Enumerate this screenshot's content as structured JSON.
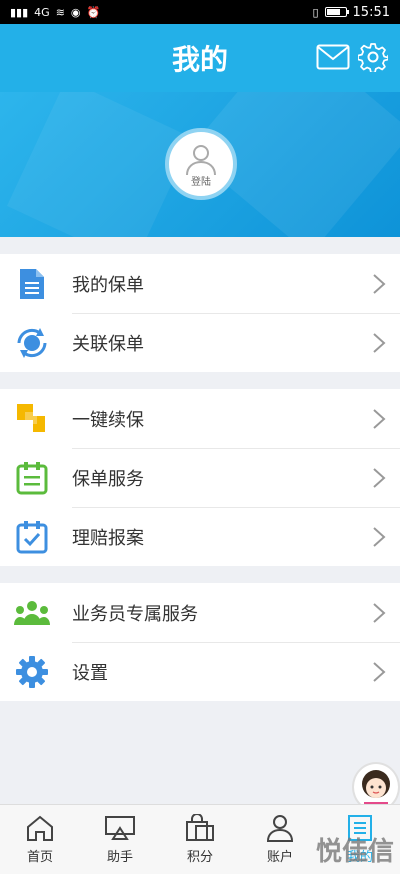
{
  "status_bar": {
    "time": "15:51",
    "network": "4G",
    "battery_level": 0.75
  },
  "header": {
    "title": "我的",
    "mail_icon": "mail-icon",
    "settings_icon": "gear-icon"
  },
  "profile": {
    "login_label": "登陆"
  },
  "menu_groups": [
    [
      {
        "label": "我的保单",
        "icon": "document-icon",
        "color": "#3d8fe0"
      },
      {
        "label": "关联保单",
        "icon": "sync-icon",
        "color": "#3d8fe0"
      }
    ],
    [
      {
        "label": "一键续保",
        "icon": "puzzle-icon",
        "color": "#f5b800"
      },
      {
        "label": "保单服务",
        "icon": "clipboard-icon",
        "color": "#5bbb3c"
      },
      {
        "label": "理赔报案",
        "icon": "calendar-check-icon",
        "color": "#3d8fe0"
      }
    ],
    [
      {
        "label": "业务员专属服务",
        "icon": "people-icon",
        "color": "#5bbb3c"
      },
      {
        "label": "设置",
        "icon": "settings-gear-icon",
        "color": "#3d8fe0"
      }
    ]
  ],
  "tabs": [
    {
      "label": "首页",
      "icon": "home-icon"
    },
    {
      "label": "助手",
      "icon": "cast-icon"
    },
    {
      "label": "积分",
      "icon": "shopping-bag-icon"
    },
    {
      "label": "账户",
      "icon": "user-icon"
    },
    {
      "label": "我的",
      "icon": "list-icon",
      "active": true
    }
  ],
  "watermark": "悦佳信",
  "colors": {
    "accent": "#23b0e8"
  }
}
